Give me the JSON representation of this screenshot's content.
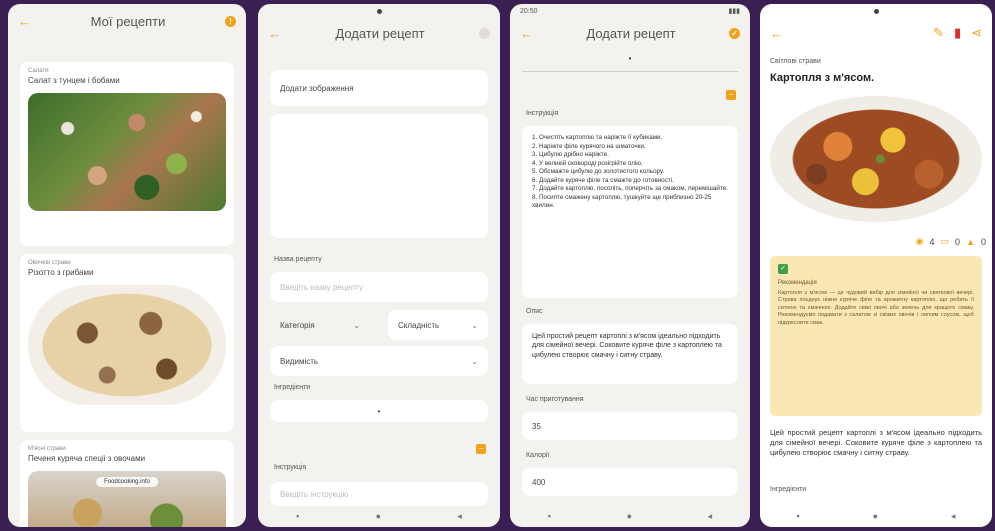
{
  "colors": {
    "accent": "#f2a21a",
    "background": "#3a1f52",
    "success": "#3fa04a",
    "danger": "#d9302c"
  },
  "screen1": {
    "title": "Мої рецепти",
    "cards": [
      {
        "category": "Салати",
        "name": "Салат з тунцем і бобами"
      },
      {
        "category": "Овочеві страви",
        "name": "Різотто з грибами"
      },
      {
        "category": "М'ясні страви",
        "name": "Печеня куряча спеціі з овочами",
        "watermark": "Foodcooking.info"
      }
    ]
  },
  "screen2": {
    "title": "Додати рецепт",
    "add_image": "Додати зображення",
    "name_label": "Назва рецепту",
    "name_placeholder": "Введіть назву рецепту",
    "category": "Категорія",
    "difficulty": "Складність",
    "visibility": "Видимість",
    "ingredients_label": "Інгредієнти",
    "instructions_label": "Інструкція",
    "instructions_placeholder": "Введіть інструкцію"
  },
  "screen3": {
    "time": "20:50",
    "title": "Додати рецепт",
    "instructions_label": "Інструкція",
    "steps": [
      "1. Очистіть картоплю та наріжте її кубиками.",
      "2. Наріжте філе курячого на шматочки.",
      "3. Цибулю дрібно наріжте.",
      "4. У великій сковороді розігрійте олію.",
      "5. Обсмажте цибулю до золотистого кольору.",
      "6. Додайте куряче філе та смажте до готовності.",
      "7. Додайте картоплю, посоліть, поперчіть за смаком, перемішайте.",
      "8. Посипте смажену картоплю, тушкуйте ще приблизно 20-25 хвилин."
    ],
    "description_label": "Опис",
    "description": "Цей простий рецепт картоплі з м'ясом ідеально підходить для сімейної вечері. Соковите куряче філе з картоплею та цибулею створює смачну і ситну страву.",
    "prep_time_label": "Час приготування",
    "prep_time": "35",
    "calories_label": "Калорії",
    "calories": "400"
  },
  "screen4": {
    "category": "Світлові страви",
    "title": "Картопля з м'ясом.",
    "views": "4",
    "comments": "0",
    "likes": "0",
    "recommendation_title": "Рекомендація",
    "recommendation": "Картопля з м'ясом — це чудовий вибір для сімейної чи святкової вечері. Страва поєднує ніжне куряче філе та ароматну картоплю, що робить її ситною та смачною. Додайте свіжі овочі або зелень для кращого смаку. Рекомендуємо подавати з салатом зі свіжих овочів і легким соусом, щоб підкреслити смак.",
    "description": "Цей простий рецепт картоплі з м'ясом ідеально підходить для сімейної вечері. Соковите куряче філе з картоплею та цибулею створює смачну і ситну страву.",
    "ingredients_label": "Інгредієнти"
  }
}
